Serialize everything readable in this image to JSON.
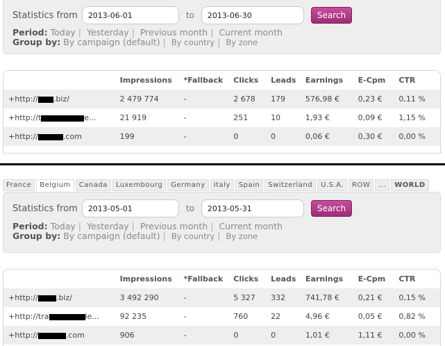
{
  "top": {
    "filter": {
      "statistics_from_label": "Statistics from",
      "date_from": "2013-06-01",
      "to_label": "to",
      "date_to": "2013-06-30",
      "search_label": "Search",
      "period_label": "Period:",
      "period_options": [
        "Today",
        "Yesterday",
        "Previous month",
        "Current month"
      ],
      "group_by_label": "Group by:",
      "group_by_options": [
        "By campaign (default)",
        "By country",
        "By zone"
      ]
    },
    "table": {
      "columns": [
        "",
        "Impressions",
        "*Fallback",
        "Clicks",
        "Leads",
        "Earnings",
        "E-Cpm",
        "CTR"
      ],
      "rows": [
        {
          "site_prefix": "+http://",
          "site_suffix": ".biz/",
          "impressions": "2 479 774",
          "fallback": "-",
          "clicks": "2 678",
          "leads": "179",
          "earnings": "576,98 €",
          "ecpm": "0,23 €",
          "ctr": "0,11 %"
        },
        {
          "site_prefix": "+http://t",
          "site_suffix": "e...",
          "impressions": "21 919",
          "fallback": "-",
          "clicks": "251",
          "leads": "10",
          "earnings": "1,93 €",
          "ecpm": "0,09 €",
          "ctr": "1,15 %"
        },
        {
          "site_prefix": "+http://",
          "site_suffix": ".com",
          "impressions": "199",
          "fallback": "-",
          "clicks": "0",
          "leads": "0",
          "earnings": "0,06 €",
          "ecpm": "0,30 €",
          "ctr": "0,00 %"
        }
      ]
    }
  },
  "bottom": {
    "tabs": [
      "France",
      "Belgium",
      "Canada",
      "Luxembourg",
      "Germany",
      "Italy",
      "Spain",
      "Switzerland",
      "U.S.A.",
      "ROW",
      "...",
      "WORLD"
    ],
    "active_tab": "Belgium",
    "filter": {
      "statistics_from_label": "Statistics from",
      "date_from": "2013-05-01",
      "to_label": "to",
      "date_to": "2013-05-31",
      "search_label": "Search",
      "period_label": "Period:",
      "period_options": [
        "Today",
        "Yesterday",
        "Previous month",
        "Current month"
      ],
      "group_by_label": "Group by:",
      "group_by_options": [
        "By campaign (default)",
        "By country",
        "By zone"
      ]
    },
    "table": {
      "columns": [
        "",
        "Impressions",
        "*Fallback",
        "Clicks",
        "Leads",
        "Earnings",
        "E-Cpm",
        "CTR"
      ],
      "rows": [
        {
          "site_prefix": "+http://",
          "site_suffix": ".biz/",
          "impressions": "3 492 290",
          "fallback": "-",
          "clicks": "5 327",
          "leads": "332",
          "earnings": "741,78 €",
          "ecpm": "0,21 €",
          "ctr": "0,15 %"
        },
        {
          "site_prefix": "+http://tra",
          "site_suffix": "ie...",
          "impressions": "92 235",
          "fallback": "-",
          "clicks": "760",
          "leads": "22",
          "earnings": "4,96 €",
          "ecpm": "0,05 €",
          "ctr": "0,82 %"
        },
        {
          "site_prefix": "+http://",
          "site_suffix": ".com",
          "impressions": "906",
          "fallback": "-",
          "clicks": "0",
          "leads": "0",
          "earnings": "1,01 €",
          "ecpm": "1,11 €",
          "ctr": "0,00 %"
        }
      ]
    }
  }
}
